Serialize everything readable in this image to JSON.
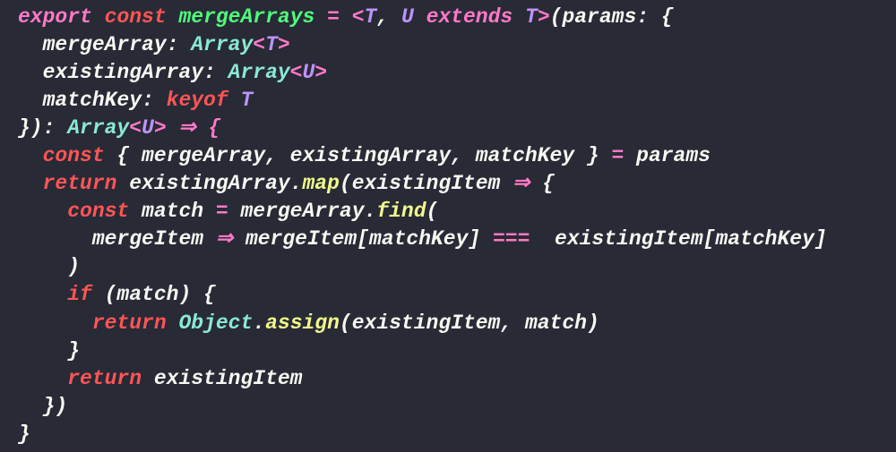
{
  "code": {
    "l1": {
      "export": "export",
      "const": "const",
      "name": "mergeArrays",
      "eq": " = ",
      "lt": "<",
      "T": "T",
      "comma": ", ",
      "U": "U",
      "extends": "extends",
      "T2": "T",
      "gt": ">",
      "lparen": "(",
      "params": "params",
      "colon": ": {",
      "end": ""
    },
    "l2": {
      "key": "mergeArray",
      "colon": ": ",
      "arr": "Array",
      "lt": "<",
      "T": "T",
      "gt": ">"
    },
    "l3": {
      "key": "existingArray",
      "colon": ": ",
      "arr": "Array",
      "lt": "<",
      "U": "U",
      "gt": ">"
    },
    "l4": {
      "key": "matchKey",
      "colon": ": ",
      "keyof": "keyof",
      "sp": " ",
      "T": "T"
    },
    "l5": {
      "close": "}): ",
      "arr": "Array",
      "lt": "<",
      "U": "U",
      "gt": ">",
      "arrow": " ⇒ {",
      "end": ""
    },
    "l6": {
      "const": "const",
      "dest": " { mergeArray, existingArray, matchKey } ",
      "eq": "= params"
    },
    "l7": {
      "return": "return",
      "var": " existingArray",
      "dot": ".",
      "map": "map",
      "open": "(existingItem ",
      "arrow": "⇒",
      "brace": " {"
    },
    "l8": {
      "const": "const",
      "match": " match ",
      "eq": "= ",
      "var": "mergeArray",
      "dot": ".",
      "find": "find",
      "open": "("
    },
    "l9": {
      "param": "mergeItem ",
      "arrow": "⇒",
      "expr1": " mergeItem[matchKey] ",
      "eqeq": "===",
      "expr2": "  existingItem[matchKey]"
    },
    "l10": {
      "close": ")"
    },
    "l11": {
      "if": "if",
      "cond": " (match) {"
    },
    "l12": {
      "return": "return",
      "obj": " Object",
      "dot": ".",
      "assign": "assign",
      "args": "(existingItem, match)"
    },
    "l13": {
      "close": "}"
    },
    "l14": {
      "return": "return",
      "var": " existingItem"
    },
    "l15": {
      "close": "})"
    },
    "l16": {
      "close": "}"
    }
  }
}
